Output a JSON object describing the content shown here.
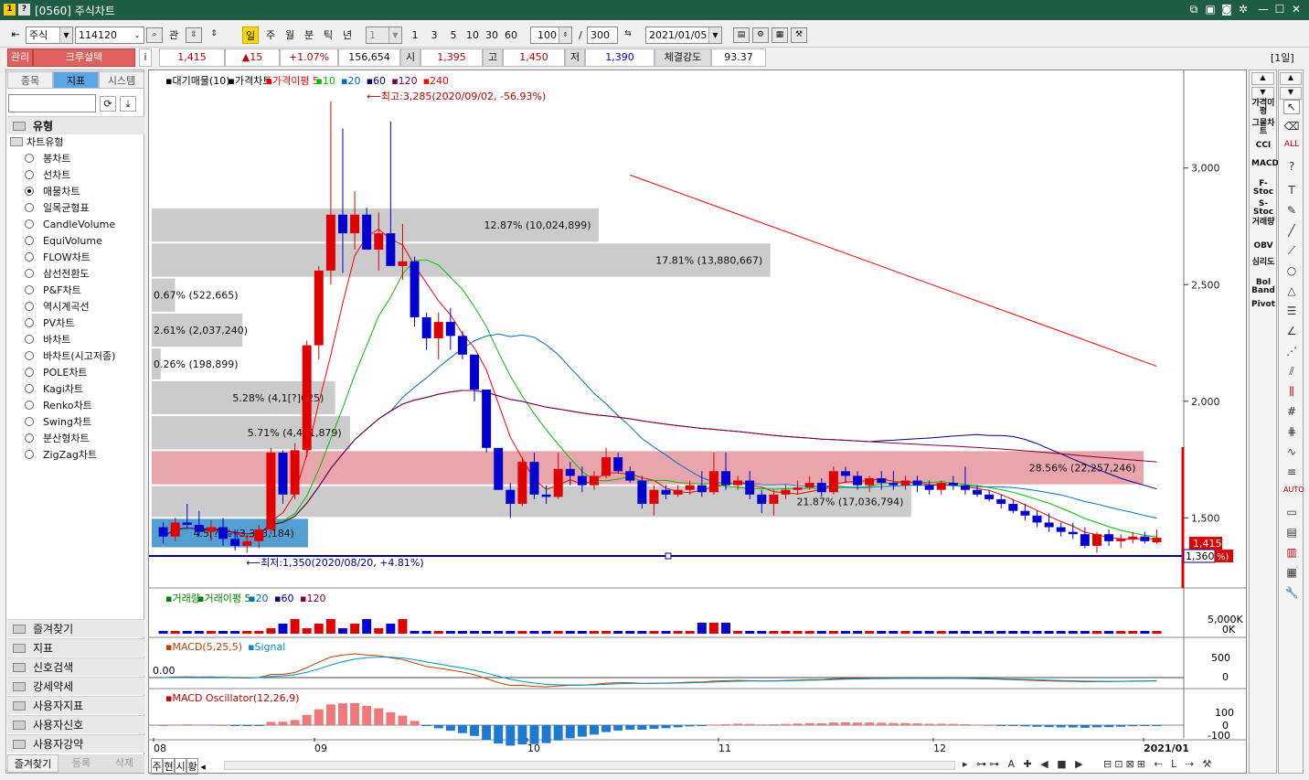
{
  "window": {
    "title": "[0560] 주식차트",
    "icon1": "1",
    "icon2": "?"
  },
  "toolbar": {
    "market": "주식",
    "code": "114120",
    "btn_gwan": "관",
    "periods": [
      "일",
      "주",
      "월",
      "분",
      "틱",
      "년"
    ],
    "interval_value": "1",
    "intervals": [
      "1",
      "3",
      "5",
      "10",
      "30",
      "60"
    ],
    "count": "100",
    "slash": "/",
    "total": "300",
    "date": "2021/01/05"
  },
  "quote": {
    "badge_manage": "관리",
    "name": "크루셜텍",
    "info": "i",
    "price": "1,415",
    "change": "▲15",
    "change_pct": "+1.07%",
    "volume": "156,654",
    "open_label": "시",
    "open": "1,395",
    "high_label": "고",
    "high": "1,450",
    "low_label": "저",
    "low": "1,390",
    "strength_label": "체결강도",
    "strength": "93.37",
    "period_tag": "[1일]"
  },
  "left_panel": {
    "tabs": [
      "종목",
      "지표",
      "시스템"
    ],
    "active_tab": 1,
    "search_value": "",
    "type_header": "유형",
    "chart_type_group": "차트유형",
    "chart_types": [
      "봉차트",
      "선차트",
      "매물차트",
      "일목균형표",
      "CandleVolume",
      "EquiVolume",
      "FLOW차트",
      "삼선전환도",
      "P&F차트",
      "역시계곡선",
      "PV차트",
      "바차트",
      "바차트(시고저종)",
      "POLE차트",
      "Kagi차트",
      "Renko차트",
      "Swing차트",
      "분산형차트",
      "ZigZag차트"
    ],
    "selected_type": 2,
    "sections": [
      "즐겨찾기",
      "지표",
      "신호검색",
      "강세약세",
      "사용자지표",
      "사용자신호",
      "사용자강약"
    ],
    "bottom_tabs": [
      "즐겨찾기",
      "등록",
      "삭제"
    ]
  },
  "right_indicators": [
    "가격이평",
    "그물차트",
    "CCI",
    "MACD",
    "F-Stoc",
    "S-Stoc",
    "거래량",
    "OBV",
    "심리도",
    "Bol Band",
    "Pivot"
  ],
  "chart_bottom": {
    "buttons": [
      "주",
      "현",
      "시",
      "황"
    ]
  },
  "chart_data": {
    "type": "candlestick",
    "price_legend": [
      "대기매물(10)",
      "가격차트",
      "가격이평 5",
      "10",
      "20",
      "60",
      "120",
      "240"
    ],
    "legend_colors": [
      "#000000",
      "#000000",
      "#ff0000",
      "#00c000",
      "#0070c0",
      "#000080",
      "#800040",
      "#ff0000"
    ],
    "y_ticks": [
      "3,000",
      "2,500",
      "2,000",
      "1,500"
    ],
    "y_tick_values": [
      3000,
      2500,
      2000,
      1500
    ],
    "ylim": [
      1270,
      3340
    ],
    "x_ticks": [
      "08",
      "09",
      "10",
      "11",
      "12",
      "2021/01"
    ],
    "high_annotation": "최고:3,285(2020/09/02, -56.93%)",
    "low_annotation": "최저:1,350(2020/08/20, +4.81%)",
    "current_price_label": "1,415",
    "cursor_price_label": "1,360",
    "cursor_price_suffix": "%)",
    "volume_profile": [
      {
        "label": "12.87% (10,024,899)",
        "low": 2680,
        "high": 2830,
        "pct": 12.87
      },
      {
        "label": "17.81% (13,880,667)",
        "low": 2530,
        "high": 2680,
        "pct": 17.81
      },
      {
        "label": "0.67% (522,665)",
        "low": 2380,
        "high": 2530,
        "pct": 0.67
      },
      {
        "label": "2.61% (2,037,240)",
        "low": 2230,
        "high": 2380,
        "pct": 2.61
      },
      {
        "label": "0.26% (198,899)",
        "low": 2090,
        "high": 2230,
        "pct": 0.26
      },
      {
        "label": "5.28% (4,1[?]625)",
        "low": 1940,
        "high": 2090,
        "pct": 5.28
      },
      {
        "label": "5.71% (4,451,879)",
        "low": 1790,
        "high": 1940,
        "pct": 5.71
      },
      {
        "label": "28.56% (22,257,246)",
        "low": 1640,
        "high": 1790,
        "pct": 28.56
      },
      {
        "label": "21.87% (17,036,794)",
        "low": 1500,
        "high": 1640,
        "pct": 21.87
      },
      {
        "label": "4.5[?]% (3,393,184)",
        "low": 1370,
        "high": 1500,
        "pct": 4.5
      }
    ],
    "candles": [
      [
        1460,
        1480,
        1390,
        1420
      ],
      [
        1420,
        1500,
        1400,
        1480
      ],
      [
        1480,
        1560,
        1450,
        1470
      ],
      [
        1470,
        1530,
        1420,
        1440
      ],
      [
        1440,
        1490,
        1400,
        1460
      ],
      [
        1460,
        1500,
        1380,
        1410
      ],
      [
        1410,
        1450,
        1360,
        1380
      ],
      [
        1380,
        1420,
        1350,
        1400
      ],
      [
        1400,
        1470,
        1370,
        1450
      ],
      [
        1450,
        1800,
        1430,
        1780
      ],
      [
        1780,
        1790,
        1560,
        1600
      ],
      [
        1600,
        1820,
        1580,
        1790
      ],
      [
        1790,
        2260,
        1760,
        2240
      ],
      [
        2240,
        2580,
        2180,
        2560
      ],
      [
        2560,
        3285,
        2500,
        2800
      ],
      [
        2800,
        3170,
        2550,
        2720
      ],
      [
        2720,
        2900,
        2650,
        2800
      ],
      [
        2800,
        2830,
        2650,
        2650
      ],
      [
        2650,
        2810,
        2560,
        2720
      ],
      [
        2720,
        3200,
        2620,
        2580
      ],
      [
        2580,
        2760,
        2520,
        2600
      ],
      [
        2600,
        2620,
        2320,
        2360
      ],
      [
        2360,
        2380,
        2220,
        2270
      ],
      [
        2270,
        2380,
        2180,
        2340
      ],
      [
        2340,
        2400,
        2220,
        2280
      ],
      [
        2280,
        2300,
        2180,
        2200
      ],
      [
        2200,
        2150,
        2000,
        2050
      ],
      [
        2050,
        1900,
        1780,
        1800
      ],
      [
        1800,
        1760,
        1620,
        1620
      ],
      [
        1620,
        1650,
        1500,
        1560
      ],
      [
        1560,
        1760,
        1550,
        1740
      ],
      [
        1740,
        1780,
        1580,
        1600
      ],
      [
        1600,
        1640,
        1560,
        1590
      ],
      [
        1590,
        1780,
        1580,
        1710
      ],
      [
        1710,
        1740,
        1640,
        1680
      ],
      [
        1680,
        1720,
        1610,
        1640
      ],
      [
        1640,
        1700,
        1620,
        1680
      ],
      [
        1680,
        1800,
        1670,
        1760
      ],
      [
        1760,
        1780,
        1690,
        1700
      ],
      [
        1700,
        1720,
        1650,
        1660
      ],
      [
        1660,
        1680,
        1540,
        1560
      ],
      [
        1560,
        1640,
        1510,
        1620
      ],
      [
        1620,
        1640,
        1580,
        1600
      ],
      [
        1600,
        1640,
        1590,
        1620
      ],
      [
        1620,
        1660,
        1600,
        1640
      ],
      [
        1640,
        1700,
        1590,
        1610
      ],
      [
        1610,
        1780,
        1600,
        1700
      ],
      [
        1700,
        1780,
        1620,
        1640
      ],
      [
        1640,
        1680,
        1620,
        1660
      ],
      [
        1660,
        1700,
        1580,
        1600
      ],
      [
        1600,
        1620,
        1520,
        1560
      ],
      [
        1560,
        1620,
        1510,
        1600
      ],
      [
        1600,
        1640,
        1580,
        1620
      ],
      [
        1620,
        1660,
        1600,
        1630
      ],
      [
        1630,
        1680,
        1620,
        1650
      ],
      [
        1650,
        1670,
        1590,
        1610
      ],
      [
        1610,
        1720,
        1600,
        1700
      ],
      [
        1700,
        1720,
        1650,
        1680
      ],
      [
        1680,
        1700,
        1620,
        1640
      ],
      [
        1640,
        1680,
        1610,
        1670
      ],
      [
        1670,
        1700,
        1620,
        1650
      ],
      [
        1650,
        1700,
        1620,
        1640
      ],
      [
        1640,
        1680,
        1620,
        1660
      ],
      [
        1660,
        1680,
        1610,
        1640
      ],
      [
        1640,
        1660,
        1600,
        1620
      ],
      [
        1620,
        1660,
        1600,
        1650
      ],
      [
        1650,
        1680,
        1620,
        1640
      ],
      [
        1640,
        1720,
        1600,
        1620
      ],
      [
        1620,
        1640,
        1590,
        1600
      ],
      [
        1600,
        1620,
        1570,
        1580
      ],
      [
        1580,
        1600,
        1540,
        1560
      ],
      [
        1560,
        1580,
        1520,
        1530
      ],
      [
        1530,
        1560,
        1490,
        1510
      ],
      [
        1510,
        1530,
        1460,
        1480
      ],
      [
        1480,
        1520,
        1440,
        1460
      ],
      [
        1460,
        1480,
        1420,
        1440
      ],
      [
        1440,
        1480,
        1410,
        1430
      ],
      [
        1430,
        1460,
        1370,
        1380
      ],
      [
        1380,
        1440,
        1350,
        1430
      ],
      [
        1430,
        1450,
        1380,
        1400
      ],
      [
        1400,
        1430,
        1370,
        1410
      ],
      [
        1410,
        1440,
        1390,
        1420
      ],
      [
        1420,
        1440,
        1390,
        1400
      ],
      [
        1395,
        1450,
        1390,
        1415
      ]
    ],
    "ma_series": [
      {
        "name": "5",
        "color": "#ff0000"
      },
      {
        "name": "10",
        "color": "#00c000"
      },
      {
        "name": "20",
        "color": "#0070c0"
      },
      {
        "name": "60",
        "color": "#000080"
      },
      {
        "name": "120",
        "color": "#800040"
      },
      {
        "name": "240",
        "color": "#ff0000"
      }
    ],
    "volume_panel": {
      "legend": [
        "거래량",
        "거래이평 5",
        "20",
        "60",
        "120"
      ],
      "y_ticks": [
        "5,000K",
        "0K"
      ]
    },
    "macd_panel": {
      "legend": [
        "MACD(5,25,5)",
        "Signal"
      ],
      "y_ticks": [
        "500",
        "0"
      ],
      "value_label": "0.00"
    },
    "osc_panel": {
      "legend": [
        "MACD Oscillator(12,26,9)"
      ],
      "y_ticks": [
        "100",
        "0",
        "-100"
      ]
    }
  }
}
